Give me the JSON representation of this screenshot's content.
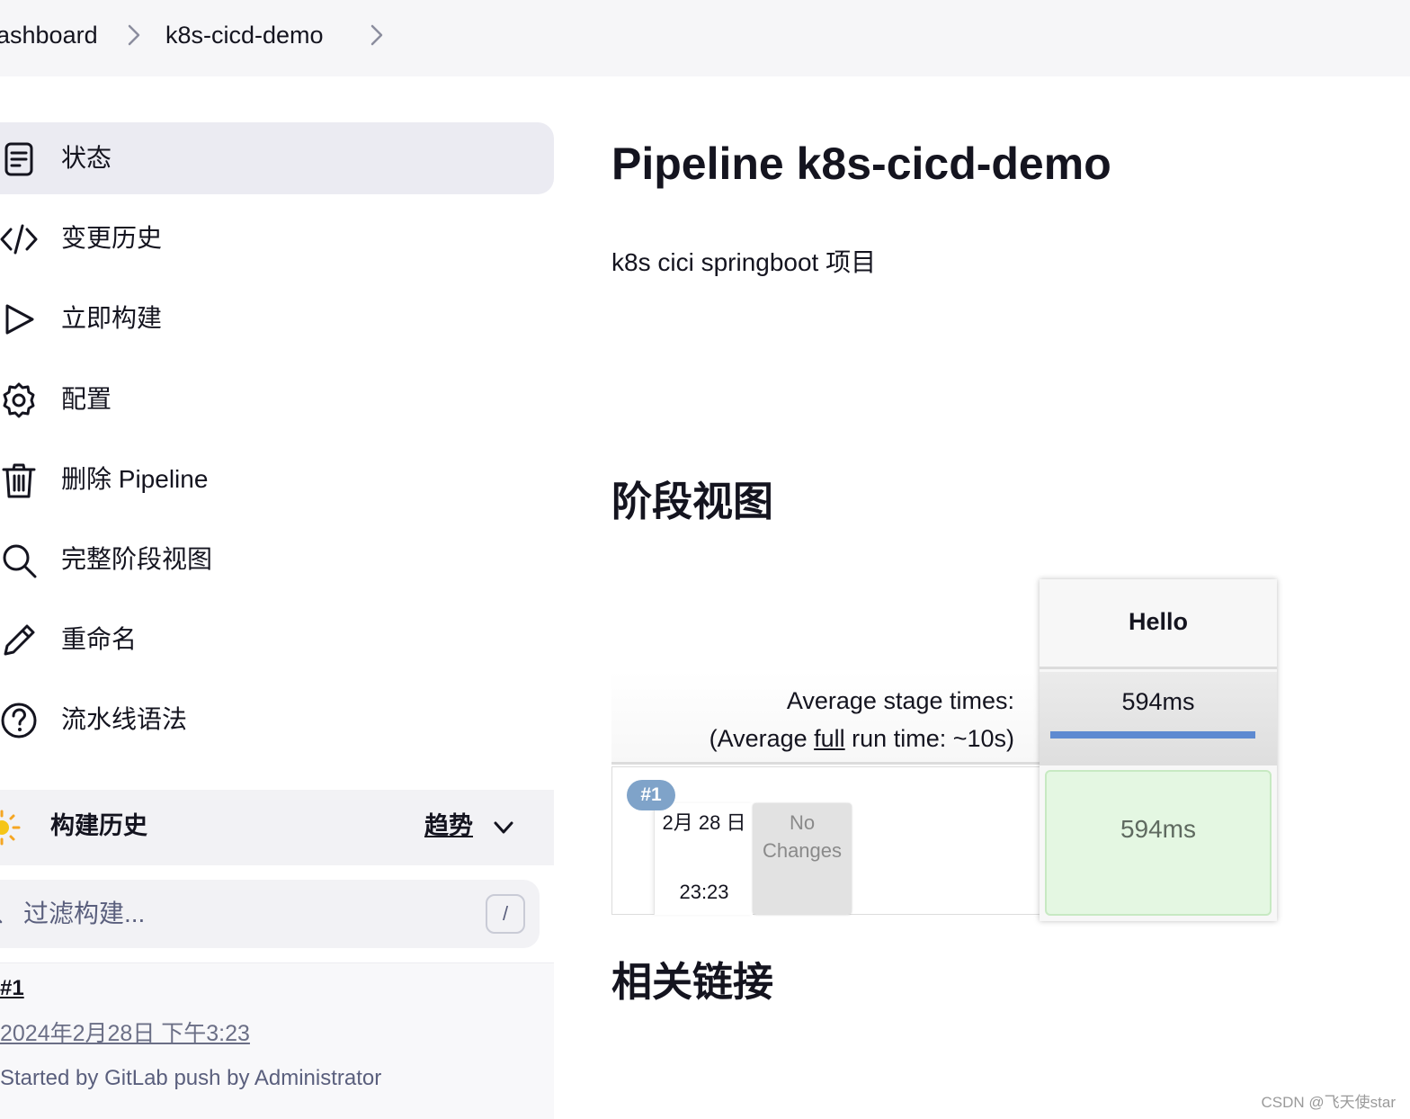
{
  "breadcrumb": {
    "items": [
      "ashboard",
      "k8s-cicd-demo"
    ]
  },
  "sidebar": {
    "items": [
      {
        "label": "状态",
        "icon": "status-icon"
      },
      {
        "label": "变更历史",
        "icon": "code-icon"
      },
      {
        "label": "立即构建",
        "icon": "play-icon"
      },
      {
        "label": "配置",
        "icon": "gear-icon"
      },
      {
        "label": "删除 Pipeline",
        "icon": "trash-icon"
      },
      {
        "label": "完整阶段视图",
        "icon": "search-icon"
      },
      {
        "label": "重命名",
        "icon": "pencil-icon"
      },
      {
        "label": "流水线语法",
        "icon": "help-icon"
      }
    ],
    "active_index": 0
  },
  "build_history": {
    "title": "构建历史",
    "trend_label": "趋势",
    "filter_placeholder": "过滤构建...",
    "filter_shortcut": "/",
    "builds": [
      {
        "number": "#1",
        "date": "2024年2月28日 下午3:23",
        "cause": "Started by GitLab push by Administrator"
      }
    ]
  },
  "main": {
    "title": "Pipeline k8s-cicd-demo",
    "description": "k8s cici springboot 项目",
    "stage_view_title": "阶段视图",
    "related_links_title": "相关链接"
  },
  "stage_view": {
    "avg_label": "Average stage times:",
    "avg_full_prefix": "(Average ",
    "avg_full_link": "full",
    "avg_full_suffix": " run time: ~10s)",
    "stages": [
      {
        "name": "Hello",
        "avg_time": "594ms",
        "avg_bar_fraction": 1.0
      }
    ],
    "runs": [
      {
        "badge": "#1",
        "date": "2月 28 日",
        "time": "23:23",
        "changes": "No Changes",
        "results": [
          "594ms"
        ]
      }
    ]
  },
  "watermark": "CSDN @飞天使star",
  "colors": {
    "active_item_bg": "#ebebf2",
    "success_cell": "#e4f7e2",
    "badge": "#7fa3c9",
    "progress": "#5e8ad1"
  }
}
